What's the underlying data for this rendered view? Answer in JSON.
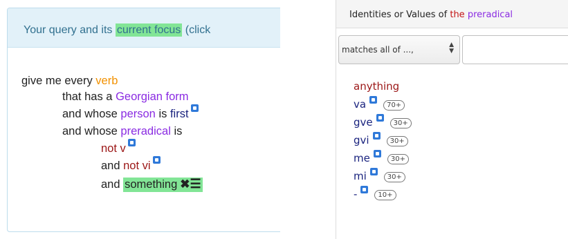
{
  "query_panel": {
    "header": {
      "prefix": "Your query and its ",
      "highlight": "current focus",
      "suffix": " (click"
    },
    "lines": {
      "l1": {
        "a": "give me every ",
        "b": "verb"
      },
      "l2": {
        "a": "that has a ",
        "b": "Georgian form"
      },
      "l3": {
        "a": "and whose ",
        "b": "person",
        "c": " is ",
        "d": "first"
      },
      "l4": {
        "a": "and whose ",
        "b": "preradical",
        "c": " is"
      },
      "l5": {
        "a": "not v"
      },
      "l6": {
        "a": "and ",
        "b": "not vi"
      },
      "l7": {
        "a": "and ",
        "b": "something"
      }
    },
    "remove_icon": "✖",
    "menu_icon": "☰"
  },
  "identities_panel": {
    "title": {
      "a": "Identities or Values of ",
      "b": "the",
      "c": " ",
      "d": "preradical"
    },
    "select": {
      "value": "matches all of ...,"
    },
    "filter_input": {
      "value": ""
    },
    "items": [
      {
        "label": "anything",
        "count": ""
      },
      {
        "label": "va",
        "count": "70+"
      },
      {
        "label": "gve",
        "count": "30+"
      },
      {
        "label": "gvi",
        "count": "30+"
      },
      {
        "label": "me",
        "count": "30+"
      },
      {
        "label": "mi",
        "count": "30+"
      },
      {
        "label": "-",
        "count": "10+"
      }
    ]
  },
  "colors": {
    "focus_highlight": "#82e596",
    "header_bg": "#e2f1f9",
    "concept_orange": "#f29100",
    "property_purple": "#8a2be2",
    "value_navy": "#1a237e",
    "negation_maroon": "#9b1616",
    "link_icon_blue": "#2f79d9"
  }
}
